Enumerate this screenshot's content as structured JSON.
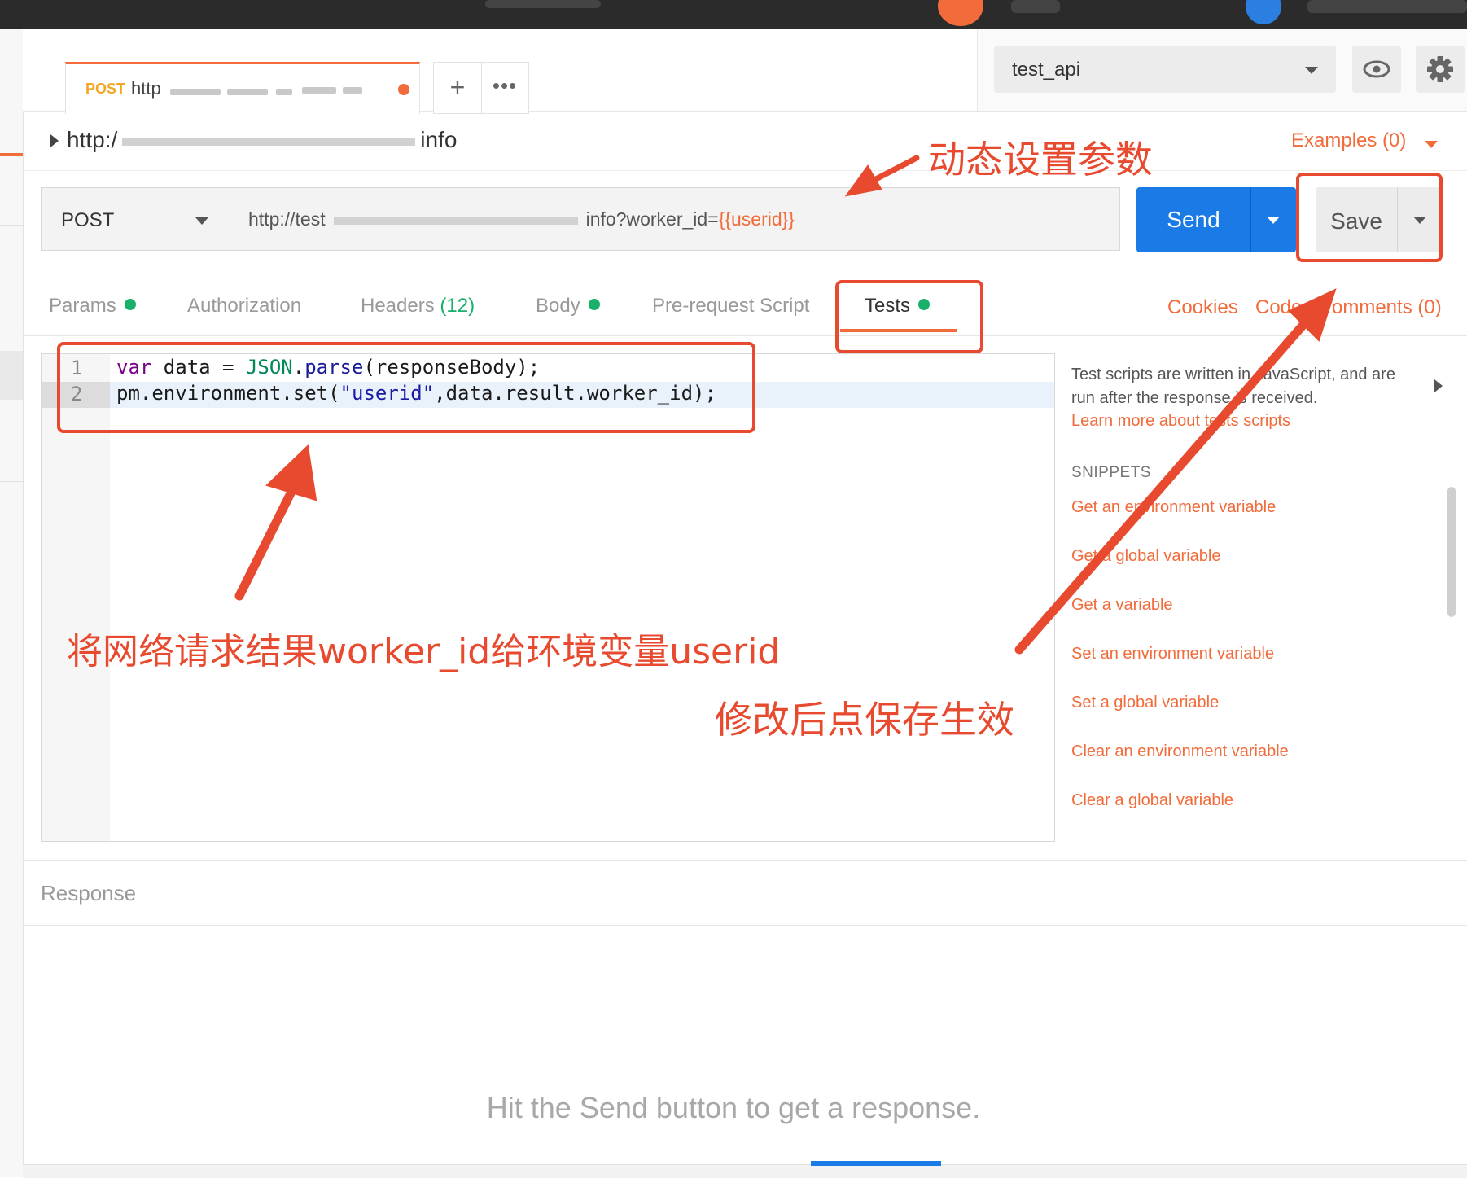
{
  "request_tab": {
    "method": "POST",
    "url_prefix": "http"
  },
  "environment": {
    "name": "test_api"
  },
  "breadcrumb": {
    "url_start": "http:/",
    "url_end": "info"
  },
  "examples": "Examples (0)",
  "request": {
    "method": "POST",
    "url_start": "http://test",
    "url_tail": "info?worker_id=",
    "url_var": "{{userid}}"
  },
  "buttons": {
    "send": "Send",
    "save": "Save"
  },
  "subtabs": {
    "params": "Params",
    "authorization": "Authorization",
    "headers": "Headers",
    "headers_count": "(12)",
    "body": "Body",
    "prerequest": "Pre-request Script",
    "tests": "Tests",
    "cookies": "Cookies",
    "code": "Code",
    "comments": "omments (0)"
  },
  "editor": {
    "line_numbers": [
      "1",
      "2"
    ],
    "line1": {
      "kw": "var",
      "mid1": " data = ",
      "obj": "JSON",
      "dot": ".",
      "fn": "parse",
      "rest": "(responseBody);"
    },
    "line2": {
      "pre": "pm.environment.set(",
      "str": "\"userid\"",
      "rest": ",data.result.worker_id);"
    }
  },
  "snippets": {
    "description": "Test scripts are written in JavaScript, and are run after the response is received.",
    "learn_more": "Learn more about tests scripts",
    "heading": "SNIPPETS",
    "items": [
      "Get an environment variable",
      "Get a global variable",
      "Get a variable",
      "Set an environment variable",
      "Set a global variable",
      "Clear an environment variable",
      "Clear a global variable"
    ]
  },
  "response": {
    "label": "Response",
    "hint": "Hit the Send button to get a response."
  },
  "annotations": {
    "dynamic_params": "动态设置参数",
    "assign_result": "将网络请求结果worker_id给环境变量userid",
    "save_hint": "修改后点保存生效"
  },
  "colors": {
    "accent": "#f26b3a",
    "send_blue": "#1a7ae6",
    "status_green": "#18b06a",
    "annotation_red": "#e84a2f"
  }
}
